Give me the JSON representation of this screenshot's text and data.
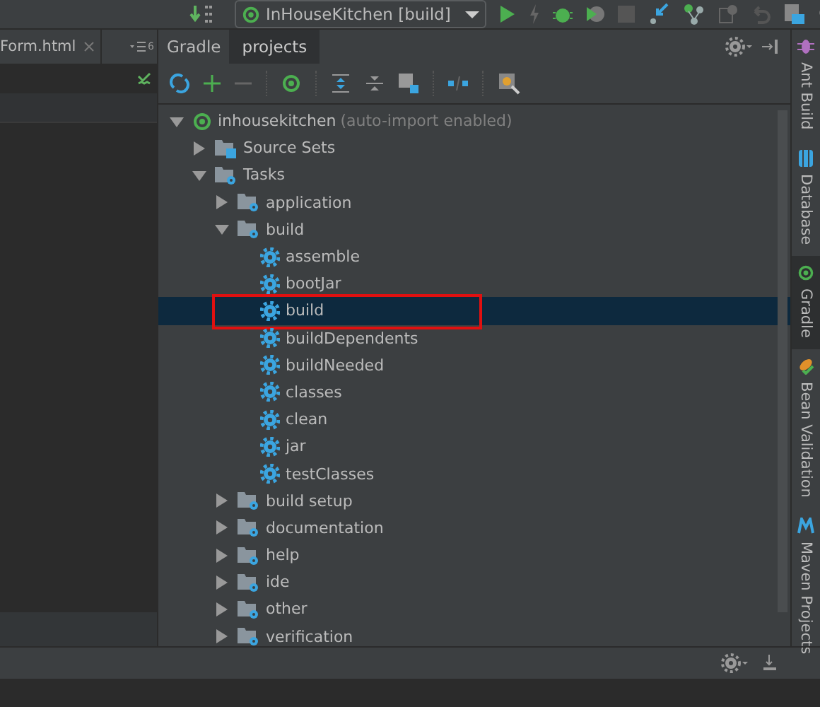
{
  "toolbar": {
    "run_config": "InHouseKitchen [build]"
  },
  "editor": {
    "tabs": [
      {
        "label": "Form.html",
        "selected": true
      }
    ],
    "hidden_tab_count": "6"
  },
  "gradle_panel": {
    "title": "Gradle",
    "tabs": [
      {
        "label": "projects",
        "selected": true
      }
    ],
    "tree": [
      {
        "kind": "project",
        "label": "inhousekitchen",
        "note": "(auto-import enabled)",
        "expanded": true,
        "selected": false,
        "children": [
          {
            "kind": "source-sets",
            "label": "Source Sets",
            "expanded": false,
            "selected": false
          },
          {
            "kind": "task-folder",
            "label": "Tasks",
            "expanded": true,
            "selected": false,
            "children": [
              {
                "kind": "task-folder",
                "label": "application",
                "expanded": false,
                "selected": false
              },
              {
                "kind": "task-folder",
                "label": "build",
                "expanded": true,
                "selected": false,
                "children": [
                  {
                    "kind": "task",
                    "label": "assemble",
                    "selected": false
                  },
                  {
                    "kind": "task",
                    "label": "bootJar",
                    "selected": false
                  },
                  {
                    "kind": "task",
                    "label": "build",
                    "selected": true,
                    "highlighted": true
                  },
                  {
                    "kind": "task",
                    "label": "buildDependents",
                    "selected": false
                  },
                  {
                    "kind": "task",
                    "label": "buildNeeded",
                    "selected": false
                  },
                  {
                    "kind": "task",
                    "label": "classes",
                    "selected": false
                  },
                  {
                    "kind": "task",
                    "label": "clean",
                    "selected": false
                  },
                  {
                    "kind": "task",
                    "label": "jar",
                    "selected": false
                  },
                  {
                    "kind": "task",
                    "label": "testClasses",
                    "selected": false
                  }
                ]
              },
              {
                "kind": "task-folder",
                "label": "build setup",
                "expanded": false,
                "selected": false
              },
              {
                "kind": "task-folder",
                "label": "documentation",
                "expanded": false,
                "selected": false
              },
              {
                "kind": "task-folder",
                "label": "help",
                "expanded": false,
                "selected": false
              },
              {
                "kind": "task-folder",
                "label": "ide",
                "expanded": false,
                "selected": false
              },
              {
                "kind": "task-folder",
                "label": "other",
                "expanded": false,
                "selected": false
              },
              {
                "kind": "task-folder",
                "label": "verification",
                "expanded": false,
                "selected": false
              }
            ]
          }
        ]
      }
    ]
  },
  "side_tool_windows": [
    {
      "label": "Ant Build",
      "kind": "ant",
      "selected": false
    },
    {
      "label": "Database",
      "kind": "database",
      "selected": false
    },
    {
      "label": "Gradle",
      "kind": "gradle",
      "selected": true
    },
    {
      "label": "Bean Validation",
      "kind": "bean",
      "selected": false
    },
    {
      "label": "Maven Projects",
      "kind": "maven",
      "selected": false
    }
  ]
}
